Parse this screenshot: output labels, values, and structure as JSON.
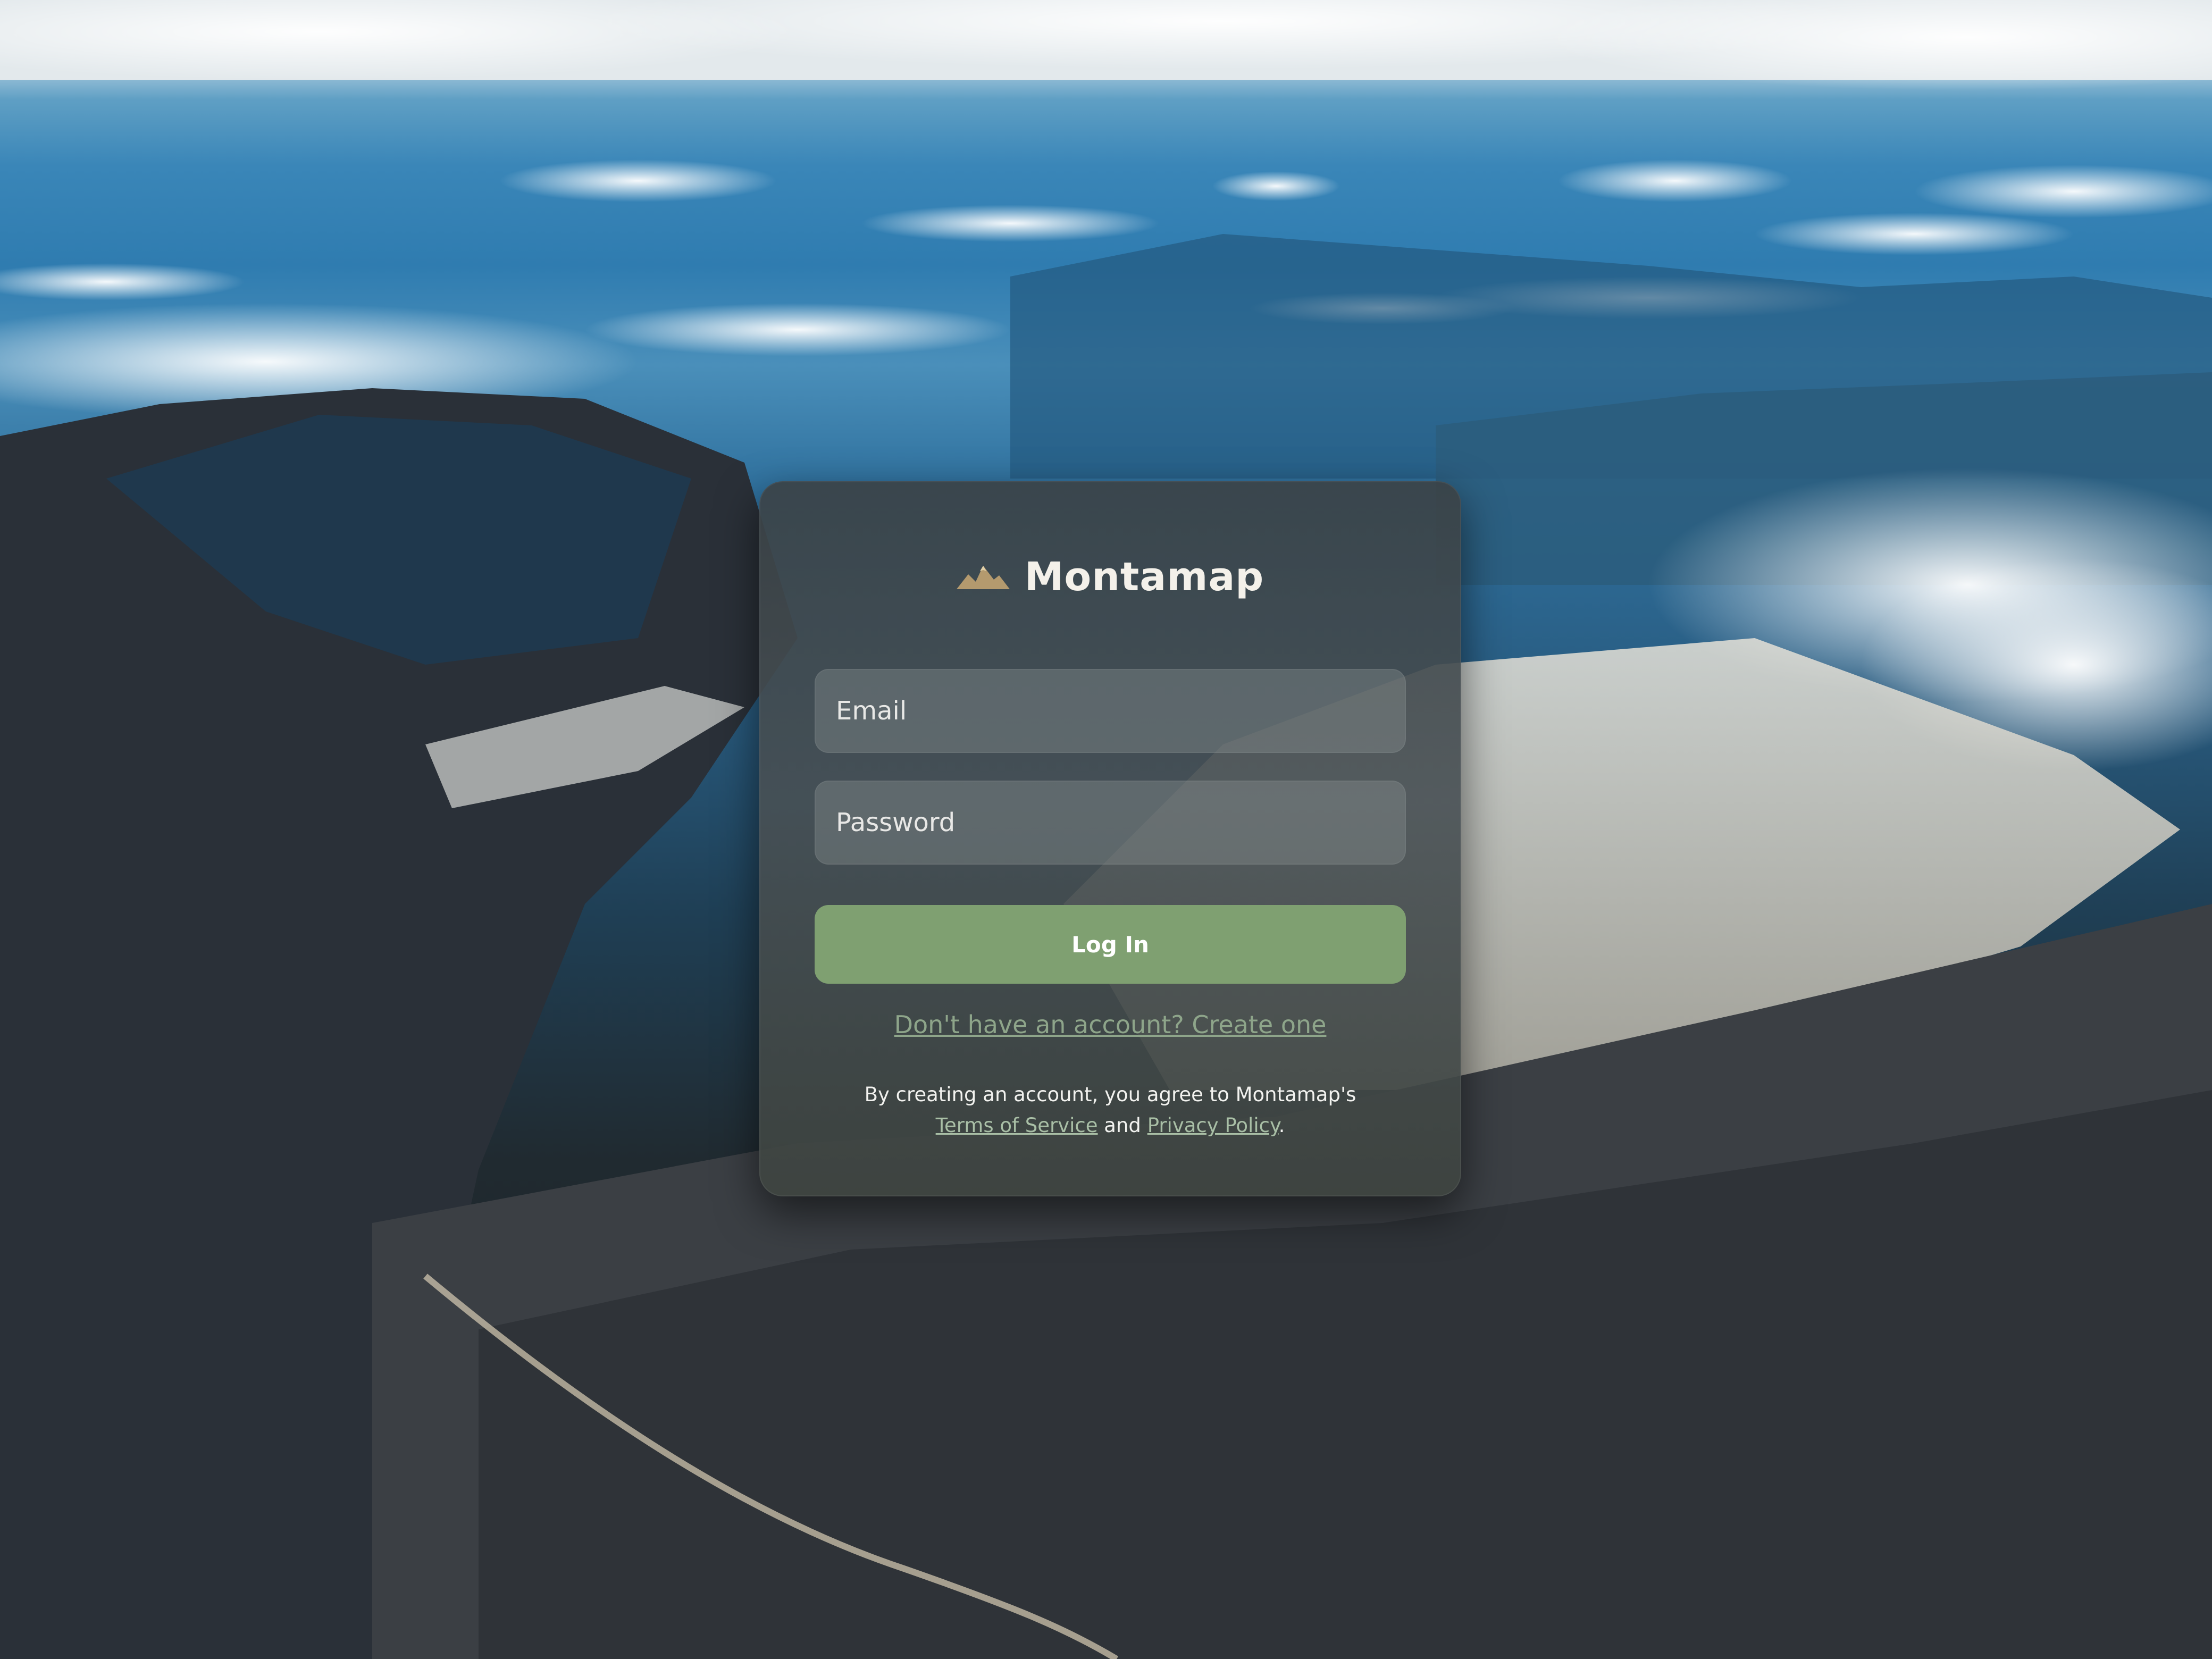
{
  "app": {
    "name": "Montamap",
    "logo_icon": "mountain-icon"
  },
  "form": {
    "email_placeholder": "Email",
    "password_placeholder": "Password",
    "login_label": "Log In",
    "signup_link": "Don't have an account? Create one"
  },
  "legal": {
    "prefix": "By creating an account, you agree to Montamap's",
    "terms_label": "Terms of Service",
    "and": "and",
    "privacy_label": "Privacy Policy",
    "suffix": "."
  },
  "colors": {
    "brand_accent": "#b49a6e",
    "login_button": "#7fa071",
    "link": "#8ea58a"
  }
}
